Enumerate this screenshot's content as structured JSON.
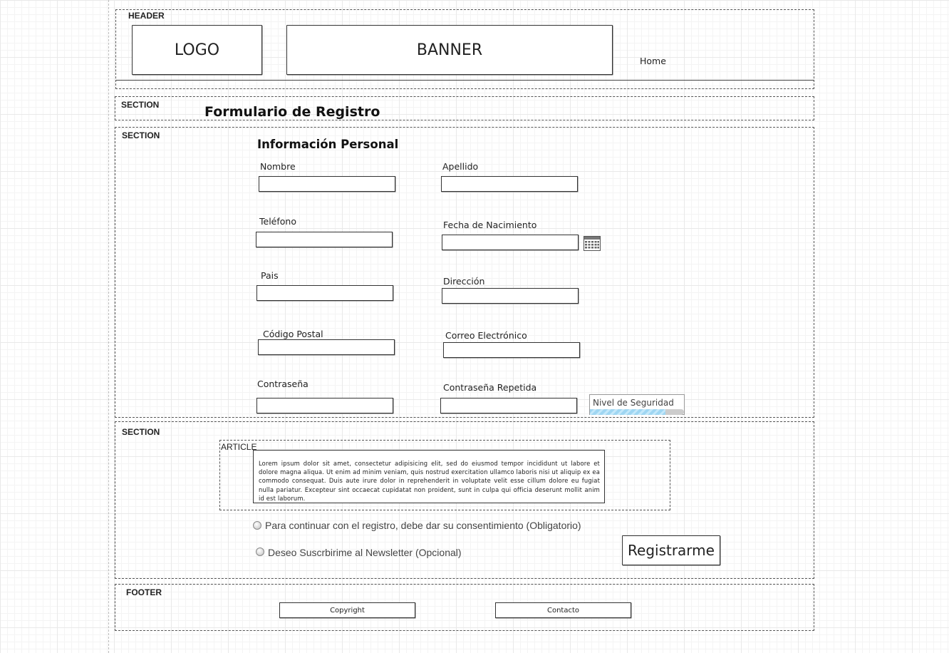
{
  "header": {
    "label": "HEADER",
    "logo": "LOGO",
    "banner": "BANNER",
    "nav_home": "Home"
  },
  "title_section": {
    "label": "SECTION",
    "title": "Formulario de Registro"
  },
  "form_section": {
    "label": "SECTION",
    "heading": "Información Personal",
    "fields": {
      "nombre": "Nombre",
      "apellido": "Apellido",
      "telefono": "Teléfono",
      "fecha_nacimiento": "Fecha de Nacimiento",
      "pais": "Pais",
      "direccion": "Dirección",
      "codigo_postal": "Código Postal",
      "correo": "Correo Electrónico",
      "contrasena": "Contraseña",
      "contrasena_repetida": "Contraseña Repetida"
    },
    "security_meter": {
      "label": "Nivel de Seguridad",
      "level": 0.8
    },
    "icons": {
      "calendar": "calendar-icon"
    }
  },
  "consent_section": {
    "label": "SECTION",
    "article_label": "ARTICLE",
    "article_text": "Lorem ipsum dolor sit amet, consectetur adipisicing elit, sed do eiusmod tempor incididunt ut labore et dolore magna aliqua. Ut enim ad minim veniam, quis nostrud exercitation ullamco laboris nisi ut aliquip ex ea commodo consequat. Duis aute irure dolor in reprehenderit in voluptate velit esse cillum dolore eu fugiat nulla pariatur. Excepteur sint occaecat cupidatat non proident, sunt in culpa qui officia deserunt mollit anim id est laborum.",
    "consent_label": "Para continuar con el registro, debe dar su consentimiento (Obligatorio)",
    "newsletter_label": "Deseo Suscrbirime al Newsletter (Opcional)",
    "submit_label": "Registrarme"
  },
  "footer": {
    "label": "FOOTER",
    "copyright": "Copyright",
    "contact": "Contacto"
  },
  "colors": {
    "meter_fill": "#9fd6f2",
    "meter_track": "#cccccc",
    "border": "#333333"
  }
}
